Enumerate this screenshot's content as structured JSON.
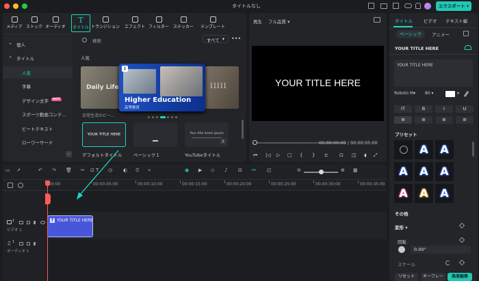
{
  "window": {
    "title": "タイトルなし",
    "export_label": "エクスポート"
  },
  "toolbar": {
    "items": [
      {
        "key": "media",
        "label": "メディア",
        "icon": "media-icon"
      },
      {
        "key": "stock",
        "label": "ストック",
        "icon": "stock-icon"
      },
      {
        "key": "audio",
        "label": "オーディオ",
        "icon": "audio-icon"
      },
      {
        "key": "title",
        "label": "タイトル",
        "icon": "title-icon"
      },
      {
        "key": "transition",
        "label": "トランジション",
        "icon": "transition-icon"
      },
      {
        "key": "effect",
        "label": "エフェクト",
        "icon": "effect-icon"
      },
      {
        "key": "filter",
        "label": "フィルター",
        "icon": "filter-icon"
      },
      {
        "key": "sticker",
        "label": "ステッカー",
        "icon": "sticker-icon"
      },
      {
        "key": "template",
        "label": "テンプレート",
        "icon": "template-icon"
      }
    ]
  },
  "sidebar": {
    "items": [
      {
        "label": "個人",
        "level": 0
      },
      {
        "label": "タイトル",
        "level": 0
      },
      {
        "label": "人気",
        "level": 1,
        "active": true
      },
      {
        "label": "字幕",
        "level": 1
      },
      {
        "label": "デザイン文字",
        "level": 1,
        "badge": "HOT"
      },
      {
        "label": "スポーツ動画コンテ...",
        "level": 1
      },
      {
        "label": "ビートテキスト",
        "level": 1
      },
      {
        "label": "ローワーサード",
        "level": 1
      }
    ]
  },
  "library": {
    "search_placeholder": "検索",
    "filter_label": "すべて",
    "section": "人気",
    "banner": {
      "title": "Higher Education",
      "subtitle": "高等教育",
      "side_left": "日常生活のビー...",
      "side_left_title": "Daily Life",
      "badge": "1"
    },
    "thumbs": [
      {
        "label": "デフォルトタイトル",
        "text": "YOUR TITLE HERE"
      },
      {
        "label": "ベーシック１",
        "text": ""
      },
      {
        "label": "YouTubeタイトル",
        "text": "Your title lorem ipsum"
      }
    ]
  },
  "preview": {
    "label": "再生",
    "quality": "フル品質",
    "title_text": "YOUR TITLE HERE",
    "current_time": "00:00:00:00",
    "total_time": "00:00:05:00",
    "separator": "/"
  },
  "inspector": {
    "tabs": [
      "タイトル",
      "ビデオ",
      "テキスト編"
    ],
    "sub_tabs": [
      "ベーシック",
      "アニメー"
    ],
    "layer_name": "YOUR TITLE HERE",
    "text_value": "YOUR TITLE HERE",
    "font": "Roboto M",
    "size": "80",
    "preset_label": "プリセット",
    "other_label": "その他",
    "transform_label": "変形",
    "rotation_label": "回転",
    "rotation_value": "0.00°",
    "scale_label": "スケール",
    "reset_label": "リセット",
    "keyframe_label": "キーフレー",
    "advanced_label": "高度編集"
  },
  "timeline": {
    "ruler": [
      "00:00",
      "00:00:05:00",
      "00:00:10:00",
      "00:00:15:00",
      "00:00:20:00",
      "00:00:25:00",
      "00:00:30:00",
      "00:00:35:00"
    ],
    "tracks": [
      {
        "label": "ビデオ 1",
        "num": "1"
      },
      {
        "label": "オーディオ 1",
        "num": "1"
      }
    ],
    "clip_label": "YOUR TITLE HERE"
  },
  "colors": {
    "accent": "#1fd5c2",
    "clip": "#4857d9",
    "export": "#22c7b5",
    "playhead": "#ff5a5a"
  }
}
